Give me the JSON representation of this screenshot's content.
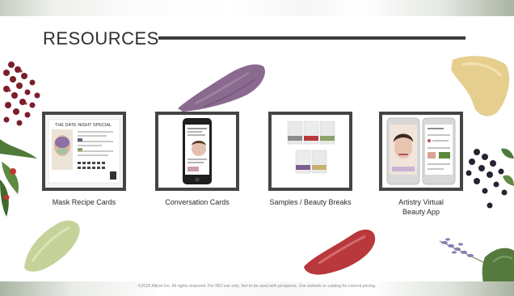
{
  "title": "RESOURCES",
  "resources": [
    {
      "label": "Mask Recipe Cards",
      "card_heading": "THE DATE NIGHT SPECIAL"
    },
    {
      "label": "Conversation Cards"
    },
    {
      "label": "Samples / Beauty Breaks"
    },
    {
      "label": "Artistry Virtual\nBeauty App"
    }
  ],
  "footer": "©2018 Alticor Inc. All rights reserved.  For IBO use only. Not to be used with prospects.  Use website or catalog for current pricing.",
  "colors": {
    "frame": "#454545",
    "title_rule": "#3d3d3d",
    "purple_swatch": "#8a6a8f",
    "yellow_swatch": "#e6cf8e",
    "green_swatch": "#c5d39a",
    "red_swatch": "#b8383c"
  }
}
